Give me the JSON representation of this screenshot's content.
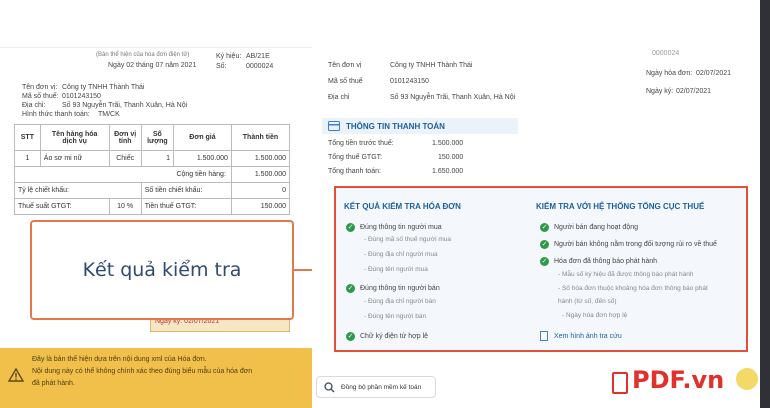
{
  "left_invoice": {
    "header_line1": "(Bản thể hiện của hóa đơn điện tử)",
    "date_line": "Ngày 02 tháng 07 năm 2021",
    "symbol_label": "Ký hiệu:",
    "symbol_value": "AB/21E",
    "number_label": "Số:",
    "number_value": "0000024",
    "unit_label": "Tên đơn vị:",
    "unit_value": "Công ty TNHH Thành Thái",
    "tax_label": "Mã số thuế:",
    "tax_value": "0101243150",
    "address_label": "Địa chỉ:",
    "address_value": "Số 93 Nguyễn Trãi, Thanh Xuân, Hà Nội",
    "payment_label": "Hình thức thanh toán:",
    "payment_value": "TM/CK",
    "columns": [
      "STT",
      "Tên hàng hóa dịch vụ",
      "Đơn vị tính",
      "Số lượng",
      "Đơn giá",
      "Thành tiền"
    ],
    "row": [
      "1",
      "Áo sơ mi nữ",
      "Chiếc",
      "1",
      "1.500.000",
      "1.500.000"
    ],
    "subtotal_label": "Cộng tiền hàng:",
    "subtotal_value": "1.500.000",
    "discount_rate_label": "Tỷ lệ chiết khấu:",
    "discount_amount_label": "Số tiền chiết khấu:",
    "discount_amount_value": "0",
    "vat_rate_label": "Thuế suất GTGT:",
    "vat_rate_value": "10 %",
    "vat_amount_label": "Tiền thuế GTGT:",
    "vat_amount_value": "150.000",
    "stamp_text": "Ngày ký: 02/07/2021",
    "warning_line1": "Đây là bản thể hiện dựa trên nội dung xml của Hóa đơn.",
    "warning_line2": "Nội dung này có thể không chính xác theo đúng biểu mẫu của hóa đơn",
    "warning_line3": "đã phát hành."
  },
  "callout": {
    "text": "Kết quả kiểm tra"
  },
  "right_details": {
    "top_right_number": "0000024",
    "invoice_date_label": "Ngày hóa đơn:",
    "invoice_date_value": "02/07/2021",
    "sign_date_label": "Ngày ký:",
    "sign_date_value": "02/07/2021",
    "unit_label": "Tên đơn vị",
    "unit_value": "Công ty TNHH Thành Thái",
    "tax_label": "Mã số thuế",
    "tax_value": "0101243150",
    "address_label": "Địa chỉ",
    "address_value": "Số 93 Nguyễn Trãi, Thanh Xuân, Hà Nội",
    "payment_heading": "THÔNG TIN THANH TOÁN",
    "pre_tax_label": "Tổng tiền trước thuế:",
    "pre_tax_value": "1.500.000",
    "vat_label": "Tổng thuế GTGT:",
    "vat_value": "150.000",
    "total_label": "Tổng thanh toán:",
    "total_value": "1.650.000"
  },
  "check_panel": {
    "left_title": "KẾT QUẢ KIỂM TRA HÓA ĐƠN",
    "right_title": "KIỂM TRA VỚI HỆ THỐNG TỔNG CỤC THUẾ",
    "buyer_ok": "Đúng thông tin người mua",
    "buyer_sub1": "- Đúng mã số thuế người mua",
    "buyer_sub2": "- Đúng địa chỉ người mua",
    "buyer_sub3": "- Đúng tên người mua",
    "seller_ok": "Đúng thông tin người bán",
    "seller_sub1": "- Đúng địa chỉ người bán",
    "seller_sub2": "- Đúng tên người bán",
    "signature_ok": "Chữ ký điện tử hợp lệ",
    "seller_active": "Người bán đang hoạt động",
    "seller_not_risk": "Người bán không nằm trong đối tượng rủi ro về thuế",
    "invoice_announced": "Hóa đơn đã thông báo phát hành",
    "announce_sub1": "- Mẫu số ký hiệu đã được thông báo phát hành",
    "announce_sub2": "- Số hóa đơn thuộc khoảng hóa đơn thông báo phát",
    "announce_sub2b": "hành (từ số, đến số)",
    "announce_sub3": "- Ngày hóa đơn hợp lệ",
    "view_image_link": "Xem hình ảnh tra cứu"
  },
  "bottom": {
    "sync_button": "Đồng bộ phần mềm kế toán",
    "logo_text": "PDF.vn"
  },
  "colors": {
    "panel_border": "#e24f3a",
    "callout_border": "#e07a4c",
    "heading_blue": "#1b5e9e",
    "check_green": "#2e9a47",
    "warning_bg": "#f1c04b"
  }
}
